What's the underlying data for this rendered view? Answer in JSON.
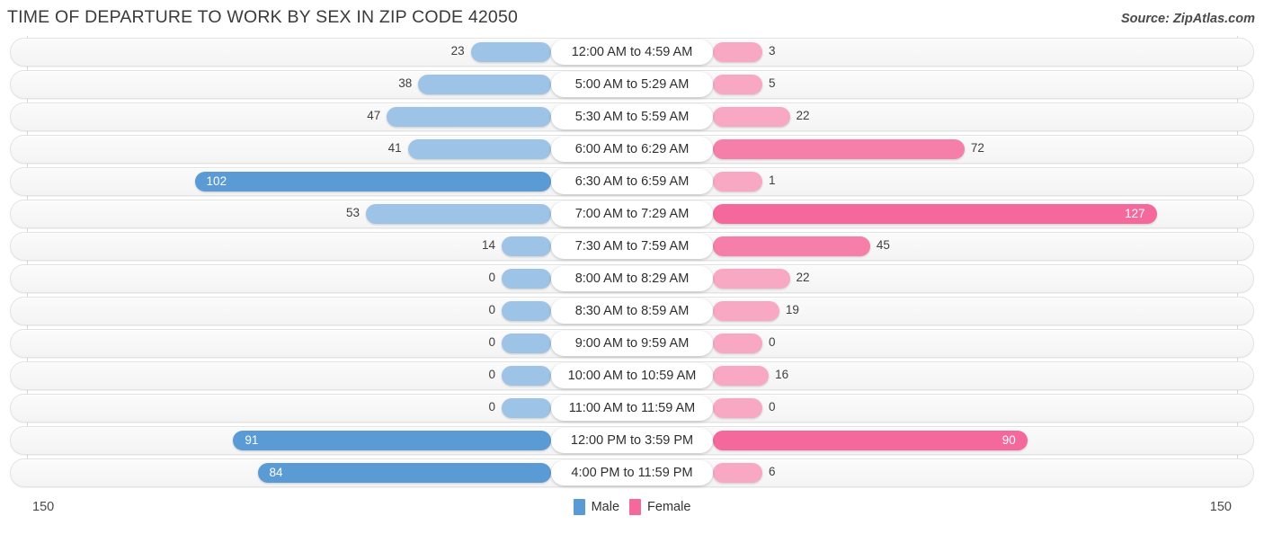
{
  "header": {
    "title": "TIME OF DEPARTURE TO WORK BY SEX IN ZIP CODE 42050",
    "source": "Source: ZipAtlas.com"
  },
  "legend": {
    "male_label": "Male",
    "female_label": "Female",
    "male_color": "#5b9bd5",
    "female_color": "#f4689b"
  },
  "axis": {
    "left_max": "150",
    "right_max": "150"
  },
  "chart_data": {
    "type": "bar",
    "title": "TIME OF DEPARTURE TO WORK BY SEX IN ZIP CODE 42050",
    "orientation": "horizontal-diverging",
    "xlabel": "",
    "ylabel": "",
    "xlim": [
      150,
      150
    ],
    "grid": false,
    "legend_position": "bottom-center",
    "categories": [
      "12:00 AM to 4:59 AM",
      "5:00 AM to 5:29 AM",
      "5:30 AM to 5:59 AM",
      "6:00 AM to 6:29 AM",
      "6:30 AM to 6:59 AM",
      "7:00 AM to 7:29 AM",
      "7:30 AM to 7:59 AM",
      "8:00 AM to 8:29 AM",
      "8:30 AM to 8:59 AM",
      "9:00 AM to 9:59 AM",
      "10:00 AM to 10:59 AM",
      "11:00 AM to 11:59 AM",
      "12:00 PM to 3:59 PM",
      "4:00 PM to 11:59 PM"
    ],
    "series": [
      {
        "name": "Male",
        "values": [
          23,
          38,
          47,
          41,
          102,
          53,
          14,
          0,
          0,
          0,
          0,
          0,
          91,
          84
        ]
      },
      {
        "name": "Female",
        "values": [
          3,
          5,
          22,
          72,
          1,
          127,
          45,
          22,
          19,
          0,
          16,
          0,
          90,
          6
        ]
      }
    ]
  },
  "rows": [
    {
      "label": "12:00 AM to 4:59 AM",
      "male": "23",
      "female": "3"
    },
    {
      "label": "5:00 AM to 5:29 AM",
      "male": "38",
      "female": "5"
    },
    {
      "label": "5:30 AM to 5:59 AM",
      "male": "47",
      "female": "22"
    },
    {
      "label": "6:00 AM to 6:29 AM",
      "male": "41",
      "female": "72"
    },
    {
      "label": "6:30 AM to 6:59 AM",
      "male": "102",
      "female": "1"
    },
    {
      "label": "7:00 AM to 7:29 AM",
      "male": "53",
      "female": "127"
    },
    {
      "label": "7:30 AM to 7:59 AM",
      "male": "14",
      "female": "45"
    },
    {
      "label": "8:00 AM to 8:29 AM",
      "male": "0",
      "female": "22"
    },
    {
      "label": "8:30 AM to 8:59 AM",
      "male": "0",
      "female": "19"
    },
    {
      "label": "9:00 AM to 9:59 AM",
      "male": "0",
      "female": "0"
    },
    {
      "label": "10:00 AM to 10:59 AM",
      "male": "0",
      "female": "16"
    },
    {
      "label": "11:00 AM to 11:59 AM",
      "male": "0",
      "female": "0"
    },
    {
      "label": "12:00 PM to 3:59 PM",
      "male": "91",
      "female": "90"
    },
    {
      "label": "4:00 PM to 11:59 PM",
      "male": "84",
      "female": "6"
    }
  ]
}
